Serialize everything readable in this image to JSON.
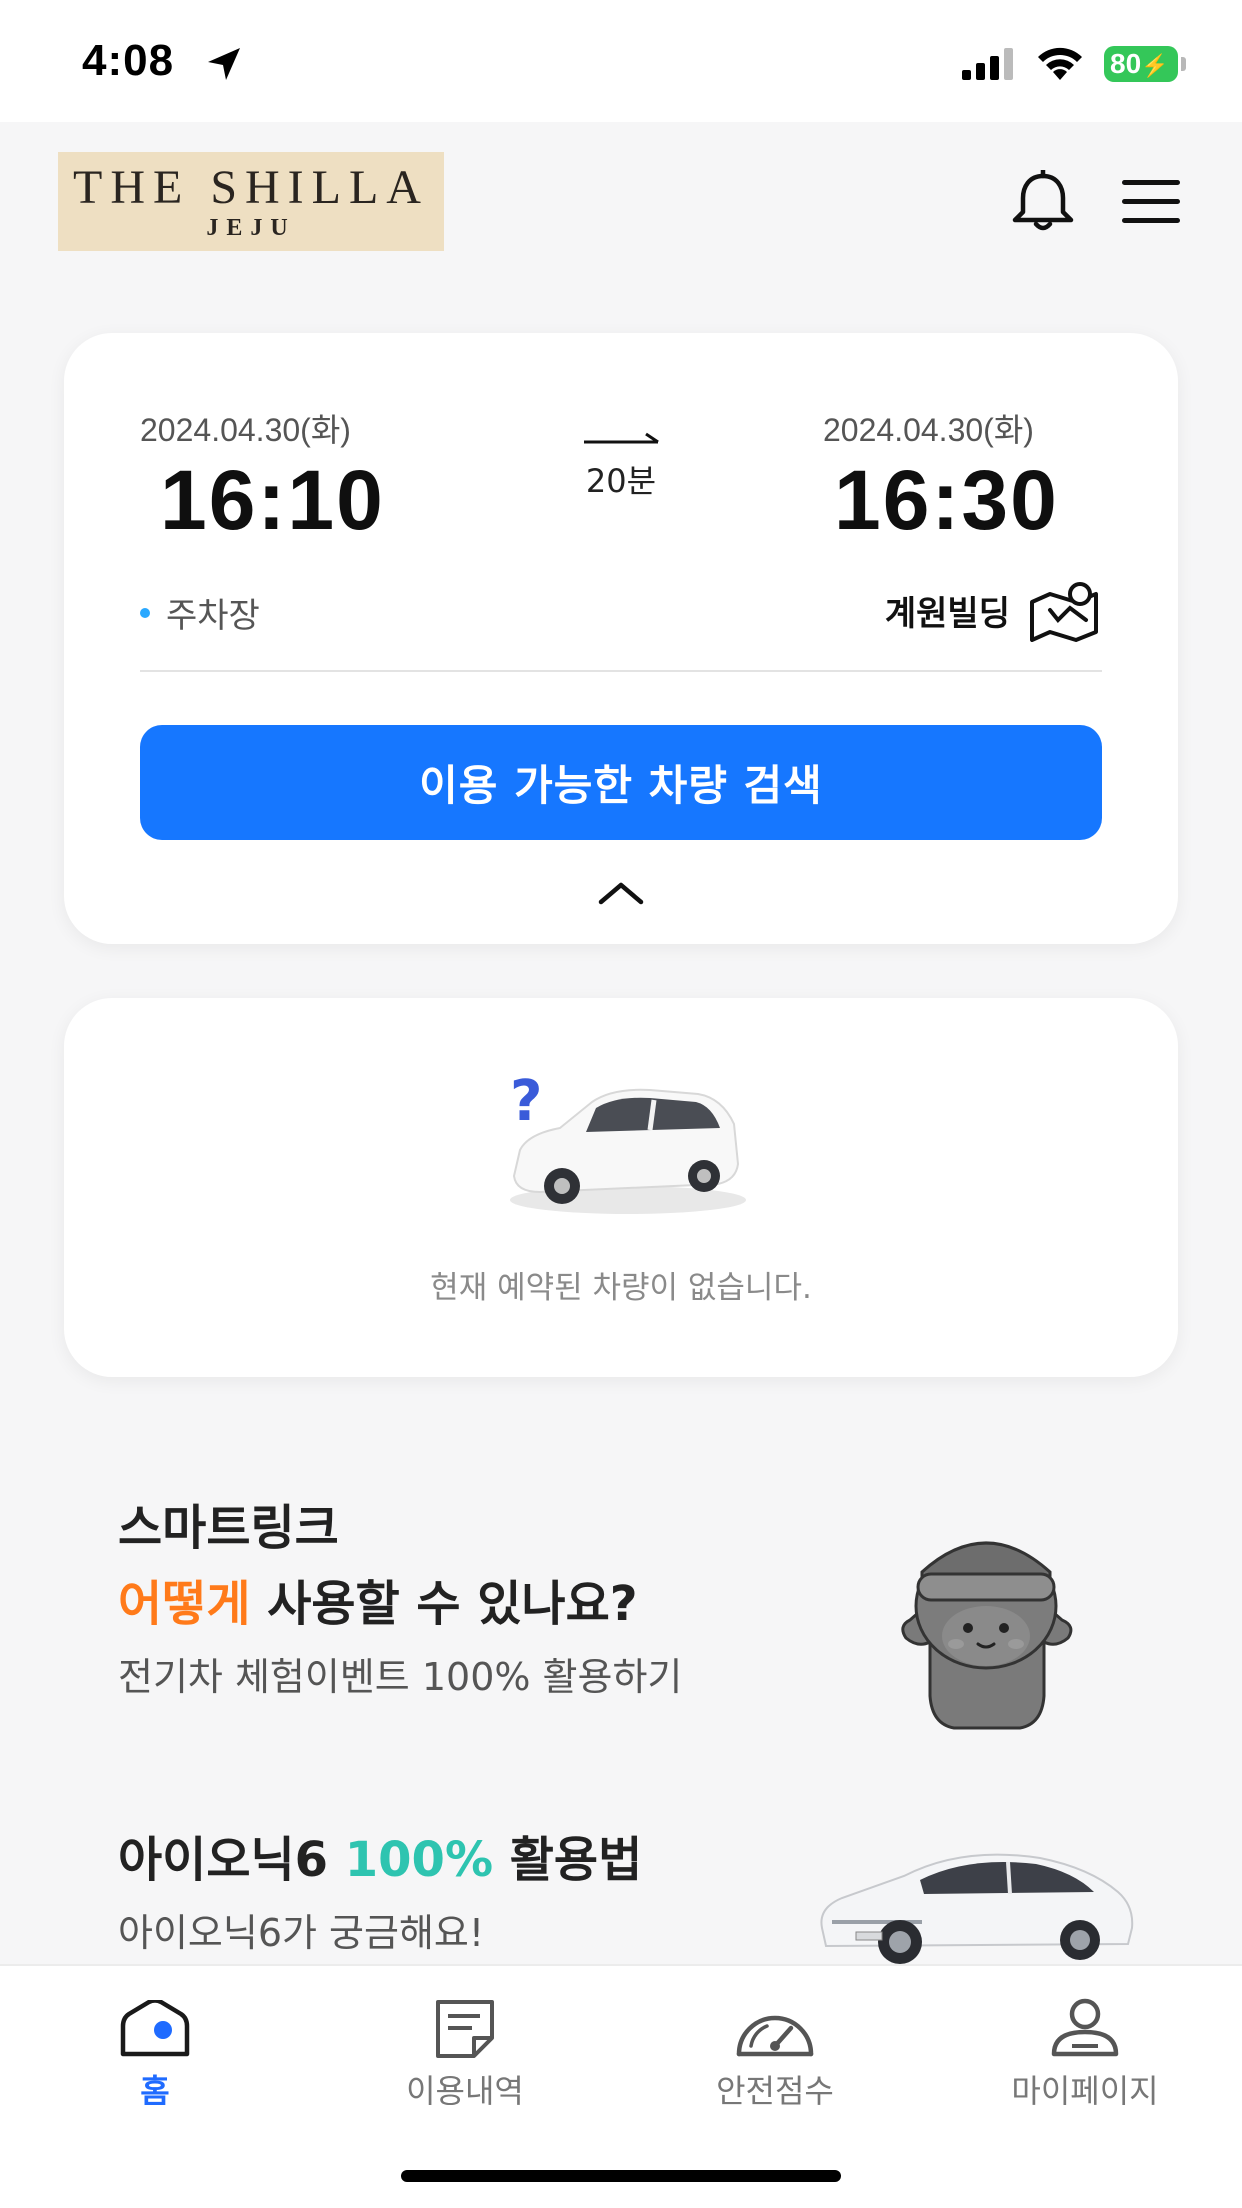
{
  "status_bar": {
    "time": "4:08",
    "battery": "80"
  },
  "header": {
    "logo_main": "THE SHILLA",
    "logo_sub": "JEJU",
    "bell_icon": "bell-icon",
    "menu_icon": "hamburger-menu-icon"
  },
  "reservation": {
    "start_date": "2024.04.30(화)",
    "start_time": "16:10",
    "end_date": "2024.04.30(화)",
    "end_time": "16:30",
    "duration": "20분",
    "start_location": "주차장",
    "end_location": "계원빌딩",
    "search_button": "이용 가능한 차량 검색"
  },
  "empty_state": {
    "message": "현재 예약된 차량이 없습니다."
  },
  "promo1": {
    "line1": "스마트링크",
    "line2_accent": "어떻게",
    "line2_rest": " 사용할 수 있나요?",
    "subtitle": "전기차 체험이벤트 100% 활용하기"
  },
  "promo2": {
    "title_start": "아이오닉6 ",
    "title_accent": "100%",
    "title_end": " 활용법",
    "subtitle": "아이오닉6가 궁금해요!"
  },
  "bottom_nav": {
    "items": [
      {
        "label": "홈",
        "icon": "home-icon"
      },
      {
        "label": "이용내역",
        "icon": "history-icon"
      },
      {
        "label": "안전점수",
        "icon": "speedometer-icon"
      },
      {
        "label": "마이페이지",
        "icon": "profile-icon"
      }
    ]
  },
  "colors": {
    "primary": "#1677ff",
    "accent_orange": "#ff7a1a",
    "accent_teal": "#2ec4b0",
    "battery": "#34c759"
  }
}
